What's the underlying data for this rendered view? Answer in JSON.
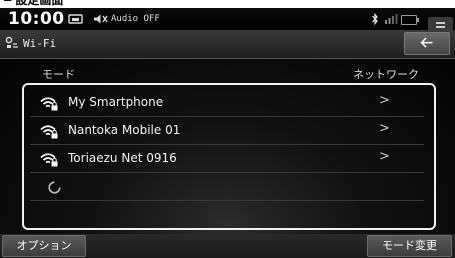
{
  "status": {
    "time": "10:00",
    "audio": "Audio OFF"
  },
  "header": {
    "title": "Wi-Fi"
  },
  "list": {
    "col_left": "モード",
    "col_right": "ネットワーク",
    "networks": [
      {
        "name": "My Smartphone"
      },
      {
        "name": "Nantoka Mobile 01"
      },
      {
        "name": "Toriaezu Net 0916"
      }
    ],
    "chevron": ">"
  },
  "footer": {
    "options_label": "オプション",
    "mode_change_label": "モード変更"
  },
  "colors": {
    "frame": "#f0f0f0",
    "background": "#000000"
  },
  "icons": [
    "car-icon",
    "mute-icon",
    "bluetooth-icon",
    "signal-icon",
    "battery-icon",
    "menu-icon",
    "wifi-settings-icon",
    "back-arrow-icon",
    "wifi-lock-icon",
    "loading-spinner-icon"
  ]
}
